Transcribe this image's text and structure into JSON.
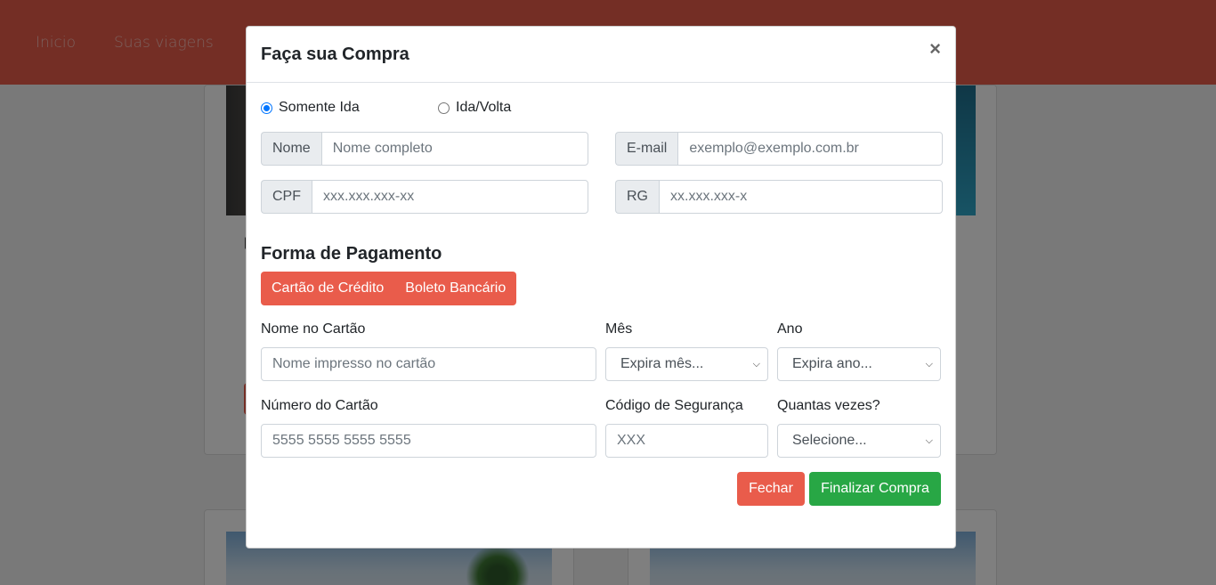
{
  "nav": {
    "items": [
      "Inicio",
      "Suas viagens"
    ]
  },
  "modal": {
    "title": "Faça sua Compra",
    "close_symbol": "×",
    "trip_type": {
      "options": [
        "Somente Ida",
        "Ida/Volta"
      ],
      "selected": "Somente Ida"
    },
    "fields": {
      "nome": {
        "label": "Nome",
        "placeholder": "Nome completo"
      },
      "email": {
        "label": "E-mail",
        "placeholder": "exemplo@exemplo.com.br"
      },
      "cpf": {
        "label": "CPF",
        "placeholder": "xxx.xxx.xxx-xx"
      },
      "rg": {
        "label": "RG",
        "placeholder": "xx.xxx.xxx-x"
      }
    },
    "payment": {
      "title": "Forma de Pagamento",
      "methods": [
        "Cartão de Crédito",
        "Boleto Bancário"
      ],
      "card_name": {
        "label": "Nome no Cartão",
        "placeholder": "Nome impresso no cartão"
      },
      "month": {
        "label": "Mês",
        "selected": "Expira mês..."
      },
      "year": {
        "label": "Ano",
        "selected": "Expira ano..."
      },
      "card_number": {
        "label": "Número do Cartão",
        "placeholder": "5555 5555 5555 5555"
      },
      "cvv": {
        "label": "Código de Segurança",
        "placeholder": "XXX"
      },
      "installments": {
        "label": "Quantas vezes?",
        "selected": "Selecione..."
      }
    },
    "buttons": {
      "close": "Fechar",
      "finish": "Finalizar Compra"
    }
  },
  "colors": {
    "accent": "#e95c4b",
    "success": "#28a745",
    "radio": "#0075ff"
  }
}
